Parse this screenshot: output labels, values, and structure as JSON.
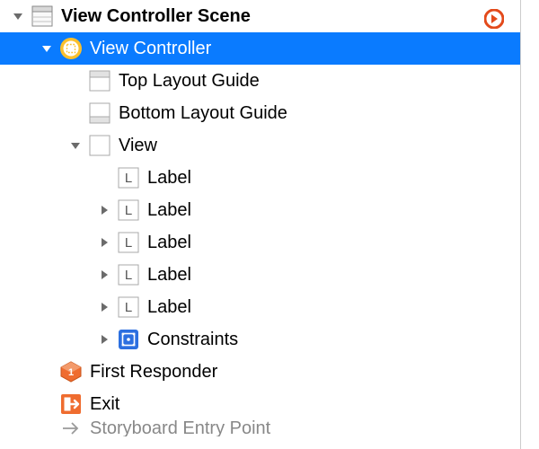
{
  "root": {
    "label": "View Controller Scene",
    "items": [
      {
        "label": "View Controller",
        "items": [
          {
            "label": "Top Layout Guide"
          },
          {
            "label": "Bottom Layout Guide"
          },
          {
            "label": "View",
            "items": [
              {
                "label": "Label"
              },
              {
                "label": "Label"
              },
              {
                "label": "Label"
              },
              {
                "label": "Label"
              },
              {
                "label": "Label"
              },
              {
                "label": "Constraints"
              }
            ]
          }
        ]
      },
      {
        "label": "First Responder"
      },
      {
        "label": "Exit"
      },
      {
        "label": "Storyboard Entry Point"
      }
    ]
  }
}
